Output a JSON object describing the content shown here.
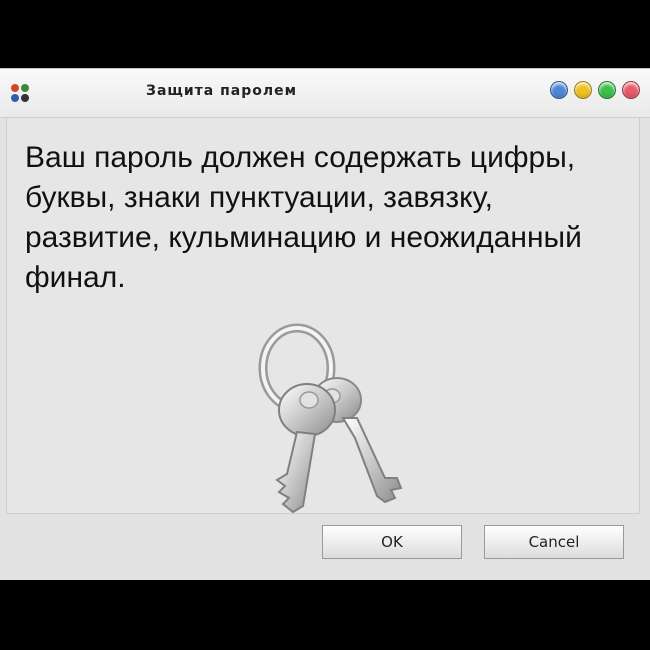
{
  "window": {
    "title": "Защита паролем",
    "app_icon": "four-dots-icon",
    "title_buttons": [
      {
        "name": "blue-button",
        "color": "#4f86d9"
      },
      {
        "name": "yellow-button",
        "color": "#f0c020"
      },
      {
        "name": "green-button",
        "color": "#3cbf4a"
      },
      {
        "name": "red-button",
        "color": "#e85a6a"
      }
    ]
  },
  "dialog": {
    "message": "Ваш пароль должен содержать цифры, буквы, знаки пунктуации, завязку, развитие, кульминацию и неожиданный финал.",
    "icon": "keys-icon"
  },
  "buttons": {
    "ok_label": "OK",
    "cancel_label": "Cancel"
  }
}
